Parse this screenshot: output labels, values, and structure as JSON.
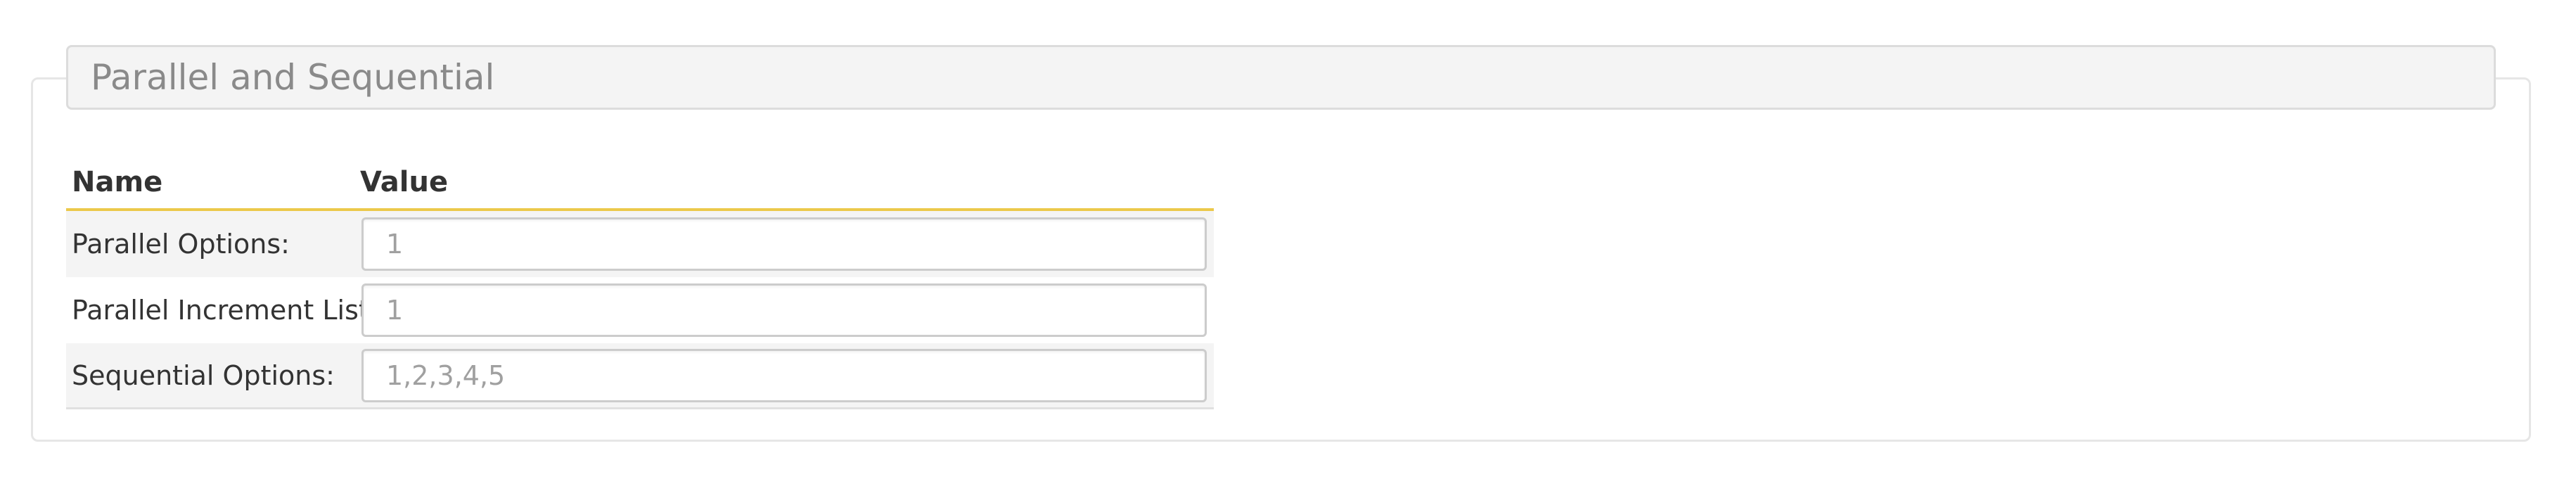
{
  "section": {
    "title": "Parallel and Sequential"
  },
  "table": {
    "headers": {
      "name": "Name",
      "value": "Value"
    },
    "rows": [
      {
        "label": "Parallel Options:",
        "placeholder": "1"
      },
      {
        "label": "Parallel Increment List:",
        "placeholder": "1"
      },
      {
        "label": "Sequential Options:",
        "placeholder": "1,2,3,4,5"
      }
    ]
  },
  "colors": {
    "header_underline": "#ecc94b",
    "legend_background": "#f4f4f4",
    "row_shade": "#f4f4f4"
  }
}
